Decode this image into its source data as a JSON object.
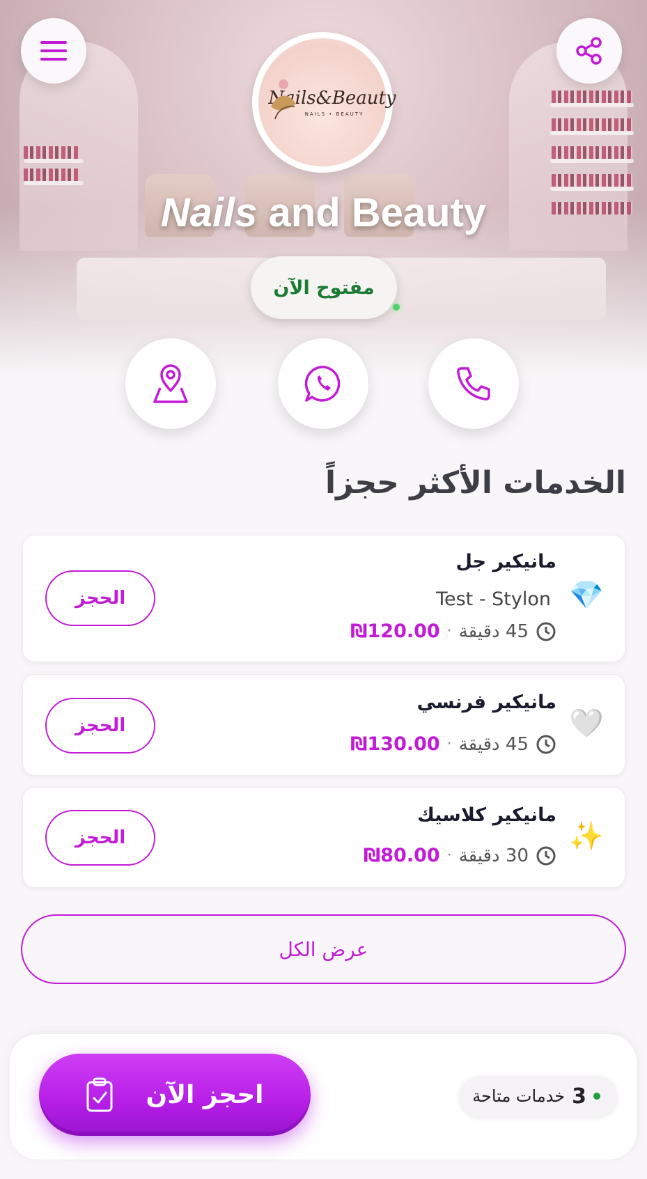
{
  "header": {
    "menu_icon": "hamburger-menu-icon",
    "share_icon": "share-icon",
    "logo_text": "Nails&Beauty",
    "logo_subtext": "NAILS • BEAUTY",
    "salon_name_part1": "Nails",
    "salon_name_part2": " and Beauty",
    "status": "مفتوح الآن",
    "status_color": "#1c7a34"
  },
  "contact": {
    "buttons": [
      {
        "name": "location",
        "icon": "map-pin-icon"
      },
      {
        "name": "whatsapp",
        "icon": "whatsapp-icon"
      },
      {
        "name": "phone",
        "icon": "phone-icon"
      }
    ]
  },
  "popular": {
    "title": "الخدمات الأكثر حجزاً",
    "services": [
      {
        "name": "مانيكير جل",
        "staff": "Test - Stylon",
        "duration": "45 دقيقة",
        "price": "₪120.00",
        "emoji": "💎",
        "book_label": "الحجز"
      },
      {
        "name": "مانيكير فرنسي",
        "duration": "45 دقيقة",
        "price": "₪130.00",
        "emoji": "🤍",
        "book_label": "الحجز"
      },
      {
        "name": "مانيكير كلاسيك",
        "duration": "30 دقيقة",
        "price": "₪80.00",
        "emoji": "✨",
        "book_label": "الحجز"
      }
    ],
    "separator": "·",
    "view_all": "عرض الكل"
  },
  "bottom": {
    "cta_label": "احجز الآن",
    "cta_icon": "clipboard-check-icon",
    "available_count": "3",
    "available_label": "خدمات متاحة"
  },
  "colors": {
    "accent": "#c21bd6",
    "background": "#f8f6f8",
    "open_green": "#1c7a34"
  }
}
